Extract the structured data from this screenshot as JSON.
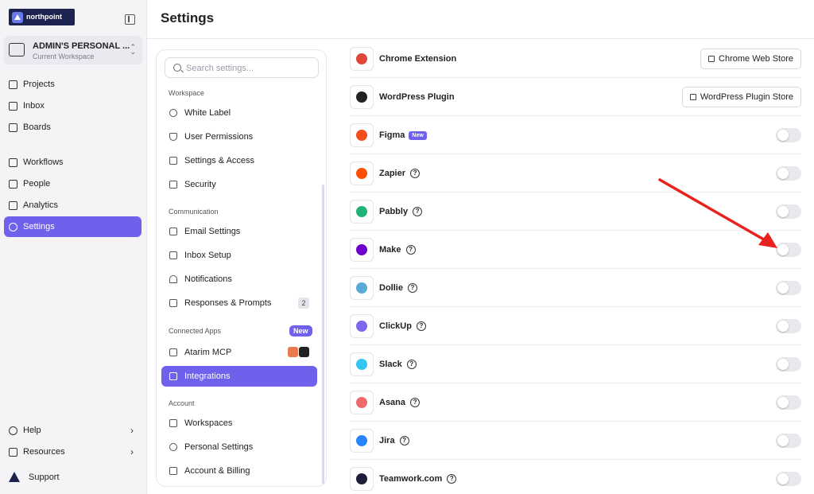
{
  "brand": {
    "logo_text": "northpoint",
    "accent": "#6f61ec",
    "logo_bg": "#1d2350"
  },
  "workspace": {
    "name": "ADMIN'S PERSONAL ...",
    "subtitle": "Current Workspace"
  },
  "sidebar": {
    "items": [
      {
        "label": "Projects",
        "icon": "grid-icon"
      },
      {
        "label": "Inbox",
        "icon": "inbox-icon"
      },
      {
        "label": "Boards",
        "icon": "board-icon"
      },
      {
        "label": "Workflows",
        "icon": "workflow-icon"
      },
      {
        "label": "People",
        "icon": "person-icon"
      },
      {
        "label": "Analytics",
        "icon": "chart-icon"
      },
      {
        "label": "Settings",
        "icon": "gear-icon",
        "active": true
      }
    ],
    "footer": [
      {
        "label": "Help",
        "icon": "help-icon"
      },
      {
        "label": "Resources",
        "icon": "bars-icon"
      }
    ],
    "support_label": "Support"
  },
  "header": {
    "title": "Settings"
  },
  "settings_nav": {
    "search_placeholder": "Search settings...",
    "sections": {
      "workspace": "Workspace",
      "communication": "Communication",
      "connected_apps": "Connected Apps",
      "account": "Account"
    },
    "connected_apps_badge": "New",
    "items": {
      "white_label": "White Label",
      "user_permissions": "User Permissions",
      "settings_access": "Settings & Access",
      "security": "Security",
      "email_settings": "Email Settings",
      "inbox_setup": "Inbox Setup",
      "notifications": "Notifications",
      "responses_prompts": "Responses & Prompts",
      "responses_count": "2",
      "atarim_mcp": "Atarim MCP",
      "integrations": "Integrations",
      "workspaces": "Workspaces",
      "personal_settings": "Personal Settings",
      "account_billing": "Account & Billing"
    }
  },
  "integrations": [
    {
      "name": "Chrome Extension",
      "icon": "chrome-icon",
      "color": "#e0463a",
      "action": "Chrome Web Store"
    },
    {
      "name": "WordPress Plugin",
      "icon": "wordpress-icon",
      "color": "#222222",
      "action": "WordPress Plugin Store"
    },
    {
      "name": "Figma",
      "icon": "figma-icon",
      "color": "#f24e1e",
      "badge": "New"
    },
    {
      "name": "Zapier",
      "icon": "zapier-icon",
      "color": "#ff4f00"
    },
    {
      "name": "Pabbly",
      "icon": "pabbly-icon",
      "color": "#20b276"
    },
    {
      "name": "Make",
      "icon": "make-icon",
      "color": "#6d00cc"
    },
    {
      "name": "Dollie",
      "icon": "dollie-icon",
      "color": "#5aa9d6"
    },
    {
      "name": "ClickUp",
      "icon": "clickup-icon",
      "color": "#7b68ee"
    },
    {
      "name": "Slack",
      "icon": "slack-icon",
      "color": "#36c5f0"
    },
    {
      "name": "Asana",
      "icon": "asana-icon",
      "color": "#f06a6a"
    },
    {
      "name": "Jira",
      "icon": "jira-icon",
      "color": "#2684ff"
    },
    {
      "name": "Teamwork.com",
      "icon": "teamwork-icon",
      "color": "#1d1c39"
    }
  ],
  "annotation": {
    "color": "#e8231f"
  }
}
